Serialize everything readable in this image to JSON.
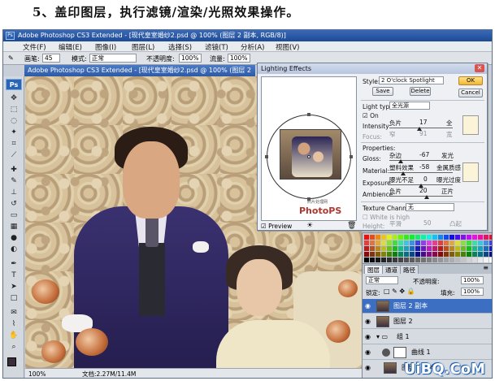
{
  "heading": "5、盖印图层，执行滤镜/渲染/光照效果操作。",
  "window": {
    "title": "Adobe Photoshop CS3 Extended - [现代皇室婚纱2.psd @ 100% (图层 2 副本, RGB/8)]",
    "menus": [
      "文件(F)",
      "编辑(E)",
      "图像(I)",
      "图层(L)",
      "选择(S)",
      "滤镜(T)",
      "分析(A)",
      "视图(V)"
    ]
  },
  "options_bar": {
    "brush_label": "画笔:",
    "brush_size": "45",
    "mode_label": "模式:",
    "mode_value": "正常",
    "opacity_label": "不透明度:",
    "opacity_value": "100%",
    "flow_label": "流量:",
    "flow_value": "100%"
  },
  "toolbox": {
    "badge": "Ps"
  },
  "status": {
    "zoom": "100%",
    "doc": "文档:2.27M/11.4M"
  },
  "dialog": {
    "title": "Lighting Effects",
    "style_label": "Style:",
    "style_value": "2 O'clock Spotlight",
    "save": "Save",
    "delete": "Delete",
    "ok": "OK",
    "cancel": "Cancel",
    "light_type_label": "Light type:",
    "light_type_value": "全光源",
    "on_label": "On",
    "intensity_label": "Intensity:",
    "intensity_left": "负片",
    "intensity_value": "17",
    "intensity_right": "全",
    "focus_label": "Focus:",
    "focus_left": "窄",
    "focus_value": "91",
    "focus_right": "宽",
    "properties_label": "Properties:",
    "gloss_label": "Gloss:",
    "gloss_left": "杂边",
    "gloss_value": "-67",
    "gloss_right": "发光",
    "material_label": "Material:",
    "material_left": "塑料效果",
    "material_value": "-58",
    "material_right": "金属质感",
    "exposure_label": "Exposure:",
    "exposure_left": "曝光不足",
    "exposure_value": "0",
    "exposure_right": "曝光过度",
    "ambience_label": "Ambience:",
    "ambience_left": "负片",
    "ambience_value": "20",
    "ambience_right": "正片",
    "texture_label": "Texture Channel:",
    "texture_value": "无",
    "white_high_label": "White is high",
    "height_label": "Height:",
    "height_left": "平滑",
    "height_value": "50",
    "height_right": "凸起",
    "preview_label": "Preview",
    "watermark_small": "照片处理网",
    "watermark": "PhotoPS"
  },
  "layers": {
    "tabs": [
      "图层",
      "通道",
      "路径"
    ],
    "blend_mode": "正常",
    "opacity_label": "不透明度:",
    "opacity_value": "100%",
    "lock_label": "锁定:",
    "fill_label": "填充:",
    "fill_value": "100%",
    "items": [
      {
        "name": "图层 2 副本",
        "selected": true
      },
      {
        "name": "图层 2",
        "selected": false
      },
      {
        "name": "组 1",
        "selected": false
      },
      {
        "name": "曲线 1",
        "selected": false
      },
      {
        "name": "图层 1 副本",
        "selected": false
      }
    ]
  },
  "site_watermark": "UiBQ.CoM"
}
